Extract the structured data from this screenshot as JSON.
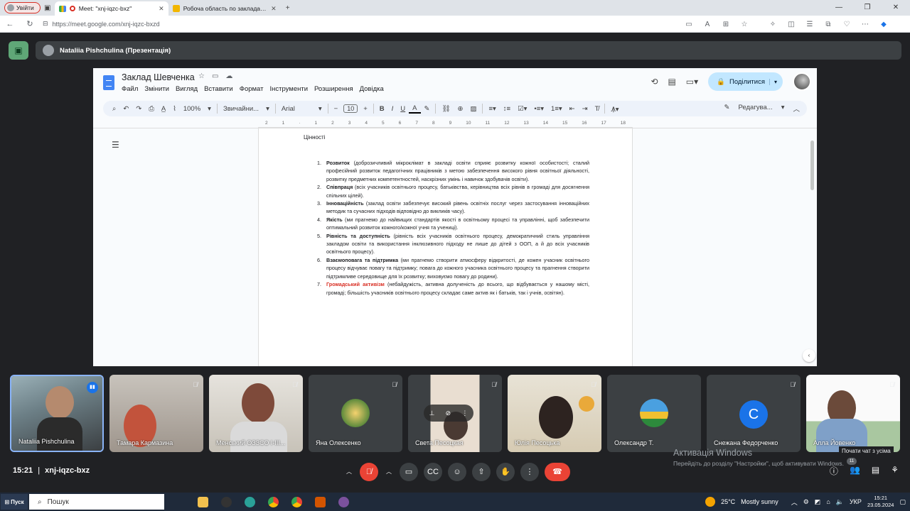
{
  "browser": {
    "profile_label": "Увійти",
    "tabs": [
      {
        "title": "Meet: \"xnj-iqzc-bxz\"",
        "active": true
      },
      {
        "title": "Робоча область по закладам осв",
        "active": false
      }
    ],
    "new_tab": "+",
    "url": "https://meet.google.com/xnj-iqzc-bxzd"
  },
  "meet": {
    "presenter_label": "Nataliia Pishchulina (Презентація)",
    "time": "15:21",
    "separator": "|",
    "meeting_code": "xnj-iqzc-bxz",
    "participants": [
      {
        "name": "Nataliia Pishchulina",
        "type": "video",
        "speaking": true
      },
      {
        "name": "Тамара Кармазина",
        "type": "video"
      },
      {
        "name": "Менський ОЗЗСО І-ІІІ...",
        "type": "video"
      },
      {
        "name": "Яна Олексенко",
        "type": "avatar-photo"
      },
      {
        "name": "Света Песоцкая",
        "type": "video"
      },
      {
        "name": "Юлія Песоцька",
        "type": "video"
      },
      {
        "name": "Олександр Т.",
        "type": "avatar-photo"
      },
      {
        "name": "Снежана Федорченко",
        "type": "avatar-letter",
        "letter": "С"
      },
      {
        "name": "Алла Йовенко",
        "type": "video"
      }
    ],
    "chat_tooltip": "Почати чат з усіма",
    "chat_badge": "11",
    "watermark_title": "Активація Windows",
    "watermark_sub": "Перейдіть до розділу \"Настройки\", щоб активувати Windows."
  },
  "docs": {
    "title": "Заклад Шевченка",
    "menu": [
      "Файл",
      "Змінити",
      "Вигляд",
      "Вставити",
      "Формат",
      "Інструменти",
      "Розширення",
      "Довідка"
    ],
    "share_label": "Поділитися",
    "zoom": "100%",
    "style": "Звичайни...",
    "font": "Arial",
    "font_size": "10",
    "mode": "Редагува...",
    "ruler_ticks": [
      "2",
      "1",
      "",
      "1",
      "2",
      "3",
      "4",
      "5",
      "6",
      "7",
      "8",
      "9",
      "10",
      "11",
      "12",
      "13",
      "14",
      "15",
      "16",
      "17",
      "18"
    ],
    "heading": "Цінності",
    "items": [
      {
        "num": "1.",
        "term": "Розвиток",
        "text": " (доброзичливий мікроклімат в закладі освіти сприяє розвитку кожної особистості; сталий професійний розвиток педагогічних працівників з метою забезпечення високого рівня освітньої діяльності, розвитку предметних компетентностей, наскрізних умінь і навичок здобувачів освіти)."
      },
      {
        "num": "2.",
        "term": "Співпраця",
        "text": " (всіх учасників освітнього процесу, батьківства, керівництва всіх рівнів в громаді для досягнення спільних цілей)."
      },
      {
        "num": "3.",
        "term": "Інноваційність",
        "text": " (заклад освіти забезпечує високий рівень освітніх послуг через застосування інноваційних методик та сучасних підходів відповідно до викликів часу)."
      },
      {
        "num": "4.",
        "term": "Якість",
        "text": " (ми прагнемо до найвищих стандартів якості в освітньому процесі та управлінні, щоб забезпечити оптимальний розвиток кожного/кожної учня та учениці)."
      },
      {
        "num": "5.",
        "term": "Рівність та доступність",
        "text": " (рівність всіх учасників освітнього процесу, демократичний стиль управління закладом освіти та використання інклюзивного підходу не лише до дітей з ООП, а й до всіх учасників освітнього процесу)."
      },
      {
        "num": "6.",
        "term": "Взаємоповага та підтримка",
        "text": " (ми прагнемо створити атмосферу відкритості, де кожен учасник освітнього процесу відчуває повагу та підтримку; повага до кожного учасника освітнього процесу та прагнення створити підтримливе середовище для їх розвитку; виховуємо повагу до родини)."
      },
      {
        "num": "7.",
        "term": "Громадський активізм",
        "text": " (небайдужість, активна долученість до всього, що відбувається у нашому місті, громаді; більшість учасників освітнього процесу складає саме актив як і батьків, так і учнів, освітян).",
        "highlight": true
      }
    ]
  },
  "taskbar": {
    "start": "Пуск",
    "search_placeholder": "Пошук",
    "weather": "25°C",
    "weather_desc": "Mostly sunny",
    "lang": "УКР",
    "time": "15:21",
    "date": "23.05.2024"
  }
}
